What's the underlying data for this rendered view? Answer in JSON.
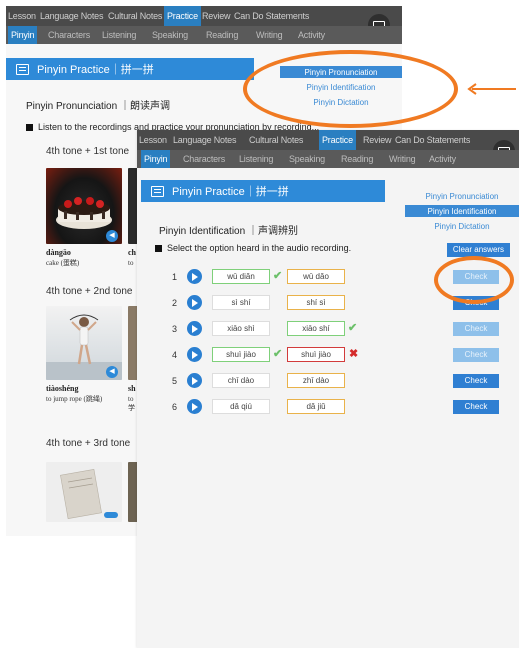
{
  "nav_tabs": [
    "Lesson",
    "Language Notes",
    "Cultural Notes",
    "Practice",
    "Review",
    "Can Do Statements"
  ],
  "subnav_tabs": [
    "Pinyin",
    "Characters",
    "Listening",
    "Speaking",
    "Reading",
    "Writing",
    "Activity"
  ],
  "back": {
    "ribbon_title": "Pinyin Practice｜拼一拼",
    "menu": [
      "Pinyin Pronunciation",
      "Pinyin Identification",
      "Pinyin Dictation"
    ],
    "heading": "Pinyin Pronunciation ｜朗读声调",
    "instruction": "Listen to the recordings and practice your pronunciation by recording...",
    "tones": [
      "4th tone + 1st tone",
      "4th tone + 2nd tone",
      "4th tone + 3rd tone"
    ],
    "cards": [
      {
        "word": "dàngāo",
        "gloss": "cake (蛋糕)"
      },
      {
        "word": "ch",
        "gloss": "to"
      },
      {
        "word": "tiàoshéng",
        "gloss": "to jump rope (跳绳)"
      },
      {
        "word": "sh",
        "gloss": "to 学"
      }
    ]
  },
  "front": {
    "ribbon_title": "Pinyin Practice｜拼一拼",
    "menu": [
      "Pinyin Pronunciation",
      "Pinyin Identification",
      "Pinyin Dictation"
    ],
    "heading": "Pinyin Identification ｜声调辨别",
    "instruction": "Select the option heard in the audio recording.",
    "clear_label": "Clear answers",
    "rows": [
      {
        "num": "1",
        "a": "wū diǎn",
        "b": "wū dǎo",
        "check": "Check"
      },
      {
        "num": "2",
        "a": "sì shí",
        "b": "shí sì",
        "check": "Check"
      },
      {
        "num": "3",
        "a": "xiāo shì",
        "b": "xiāo shí",
        "check": "Check"
      },
      {
        "num": "4",
        "a": "shuì jiào",
        "b": "shuì jiào",
        "check": "Check"
      },
      {
        "num": "5",
        "a": "chī dào",
        "b": "zhī dào",
        "check": "Check"
      },
      {
        "num": "6",
        "a": "dǎ qiú",
        "b": "dǎ jiǔ",
        "check": "Check"
      }
    ]
  },
  "colors": {
    "accent": "#2e8ad8",
    "annotation": "#f07a22",
    "correct": "#6cc06a",
    "wrong": "#d42a2a"
  }
}
